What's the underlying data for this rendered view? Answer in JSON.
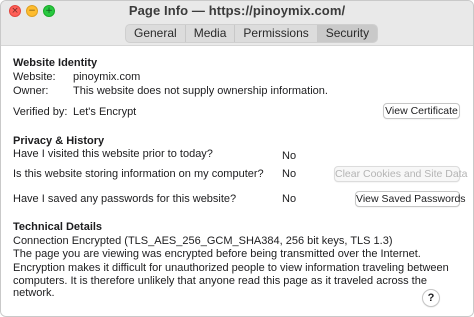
{
  "window": {
    "title": "Page Info — https://pinoymix.com/",
    "traffic_lights": {
      "close_icon": "×",
      "minimize_icon": "−",
      "zoom_icon": "+"
    }
  },
  "tabs": [
    {
      "label": "General",
      "active": false
    },
    {
      "label": "Media",
      "active": false
    },
    {
      "label": "Permissions",
      "active": false
    },
    {
      "label": "Security",
      "active": true
    }
  ],
  "identity": {
    "heading": "Website Identity",
    "website_label": "Website:",
    "website_value": "pinoymix.com",
    "owner_label": "Owner:",
    "owner_value": "This website does not supply ownership information.",
    "verified_label": "Verified by:",
    "verified_value": "Let's Encrypt",
    "view_certificate_button": "View Certificate"
  },
  "privacy": {
    "heading": "Privacy & History",
    "visited_question": "Have I visited this website prior to today?",
    "visited_answer": "No",
    "storing_question": "Is this website storing information on my computer?",
    "storing_answer": "No",
    "clear_button": "Clear Cookies and Site Data",
    "passwords_question": "Have I saved any passwords for this website?",
    "passwords_answer": "No",
    "passwords_button": "View Saved Passwords"
  },
  "technical": {
    "heading": "Technical Details",
    "connection": "Connection Encrypted (TLS_AES_256_GCM_SHA384, 256 bit keys, TLS 1.3)",
    "line2": "The page you are viewing was encrypted before being transmitted over the Internet.",
    "line3": "Encryption makes it difficult for unauthorized people to view information traveling between computers. It is therefore unlikely that anyone read this page as it traveled across the network."
  },
  "help_button": "?"
}
